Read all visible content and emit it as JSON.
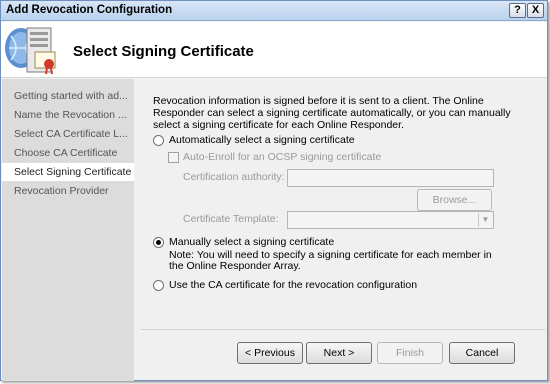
{
  "window": {
    "title": "Add Revocation Configuration",
    "help_label": "?",
    "close_label": "X"
  },
  "header": {
    "title": "Select Signing Certificate",
    "icon": "certificate-server-icon"
  },
  "sidebar": {
    "items": [
      {
        "label": "Getting started with ad...",
        "selected": false
      },
      {
        "label": "Name the Revocation ...",
        "selected": false
      },
      {
        "label": "Select CA Certificate L...",
        "selected": false
      },
      {
        "label": "Choose CA Certificate",
        "selected": false
      },
      {
        "label": "Select Signing Certificate",
        "selected": true
      },
      {
        "label": "Revocation Provider",
        "selected": false
      }
    ]
  },
  "main": {
    "description": "Revocation information is signed before it is sent to a client. The Online Responder can select a signing certificate automatically, or you can manually select a signing certificate for each Online Responder.",
    "auto_option": "Automatically select a signing certificate",
    "auto_enroll_label": "Auto-Enroll for an OCSP signing certificate",
    "ca_label": "Certification authority:",
    "ca_value": "",
    "browse_label": "Browse...",
    "template_label": "Certificate Template:",
    "template_value": "",
    "manual_option": "Manually select a signing certificate",
    "manual_note": "Note: You will need to specify a signing certificate for each member in the Online Responder Array.",
    "use_ca_option": "Use the CA certificate for the revocation configuration",
    "selected_option": "manual"
  },
  "footer": {
    "previous_label": "< Previous",
    "next_label": "Next >",
    "finish_label": "Finish",
    "cancel_label": "Cancel"
  }
}
